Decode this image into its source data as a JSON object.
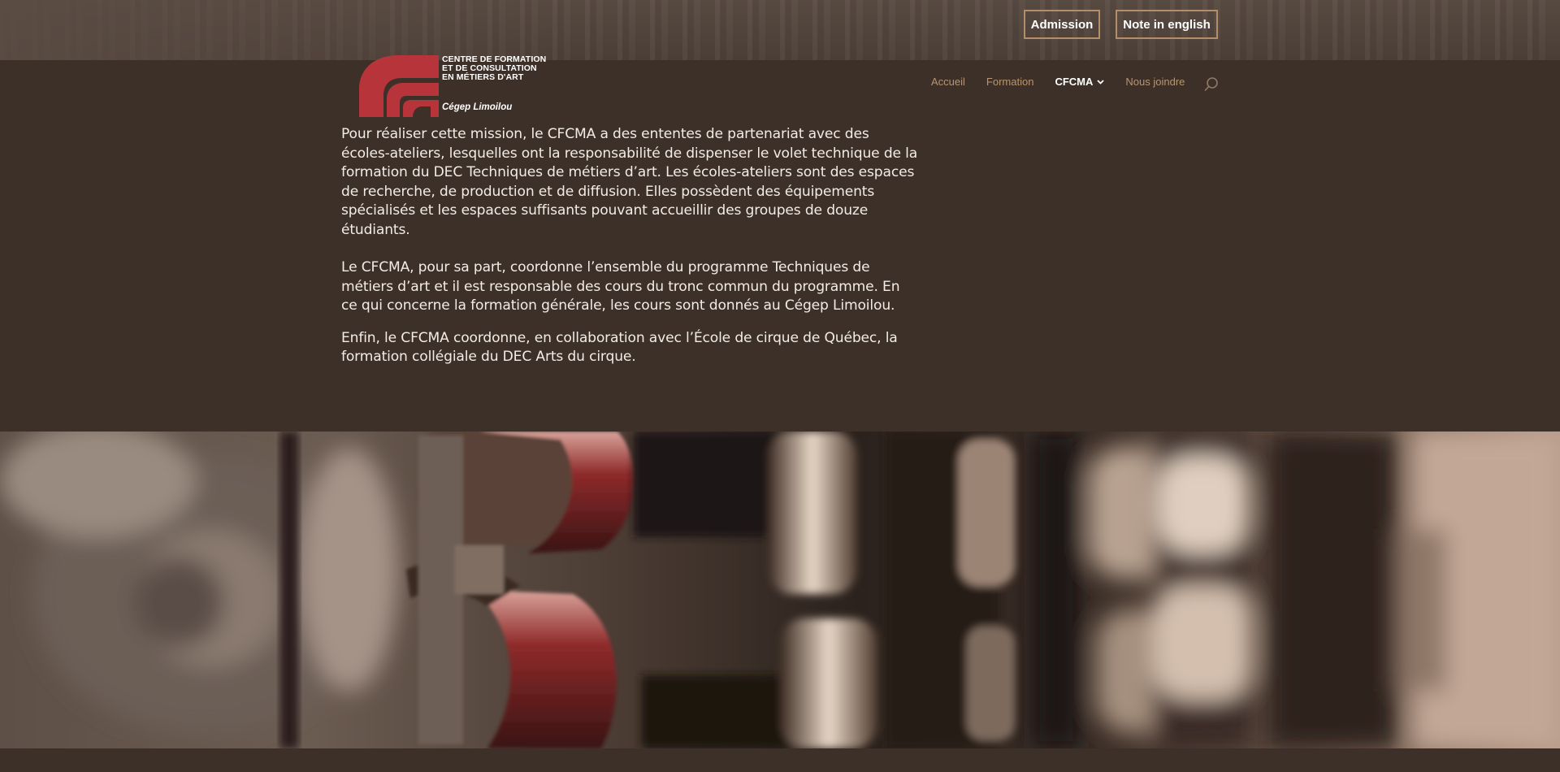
{
  "top_buttons": {
    "admission": "Admission",
    "english": "Note in english"
  },
  "logo": {
    "line1": "Centre de formation",
    "line2": "et de consultation",
    "line3": "en métiers d'art",
    "subtitle": "Cégep Limoilou",
    "mark_color": "#b7343a"
  },
  "nav": {
    "items": [
      {
        "label": "Accueil"
      },
      {
        "label": "Formation"
      },
      {
        "label": "CFCMA"
      },
      {
        "label": "Nous joindre"
      }
    ]
  },
  "content": {
    "paragraphs": [
      "Pour réaliser cette mission, le CFCMA a des ententes de partenariat avec des écoles-ateliers, lesquelles ont la responsabilité de dispenser le volet technique de la formation du DEC Techniques de métiers d’art. Les écoles-ateliers sont des espaces de recherche, de production et de diffusion. Elles possèdent des équipements spécialisés et les espaces suffisants pouvant accueillir des groupes de douze étudiants.",
      "Le CFCMA, pour sa part, coordonne l’ensemble du programme Techniques de métiers d’art et il est responsable des cours du tronc commun du programme. En ce qui concerne la formation générale, les cours sont donnés au Cégep Limoilou.",
      "Enfin, le CFCMA coordonne, en collaboration avec l’École de cirque de Québec, la formation collégiale du DEC Arts du cirque."
    ]
  },
  "colors": {
    "background": "#3d3029",
    "accent": "#b89570",
    "button_border": "#b38e68",
    "text": "#f2ece6"
  }
}
